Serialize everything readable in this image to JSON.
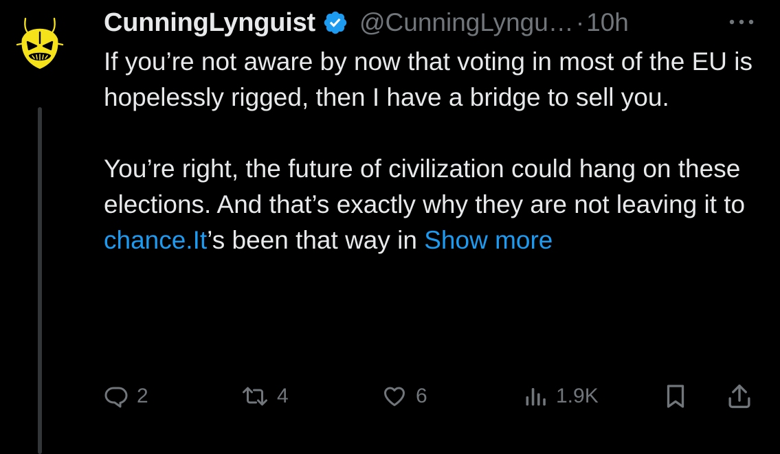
{
  "author": {
    "display_name": "CunningLynguist",
    "handle": "@CunningLyngu…",
    "separator": "·",
    "time": "10h",
    "avatar_icon": "oni-mask-icon",
    "verified_icon": "verified-badge-icon",
    "verified_color": "#1d9bf0"
  },
  "tweet": {
    "p1": "If you’re not aware by now that voting in most of the EU is hopelessly rigged, then I have a bridge to sell you.",
    "p2_before": "You’re right, the future of civilization could hang on these elections. And that’s exactly why they are not leaving it to ",
    "p2_link": "chance.It",
    "p2_after": "’s been that way in ",
    "show_more": "Show more"
  },
  "actions": {
    "replies": "2",
    "reposts": "4",
    "likes": "6",
    "views": "1.9K"
  },
  "colors": {
    "background": "#000000",
    "text": "#e7e9ea",
    "secondary": "#71767b",
    "link": "#1d9bf0",
    "avatar_accent": "#f5e21b"
  }
}
